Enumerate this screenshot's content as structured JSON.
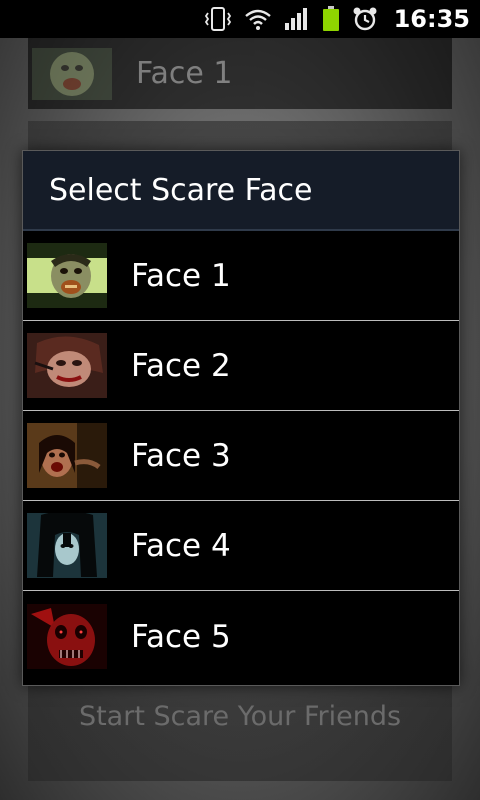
{
  "status_bar": {
    "time": "16:35",
    "icons": [
      "vibrate-icon",
      "wifi-icon",
      "signal-icon",
      "battery-icon",
      "alarm-icon"
    ]
  },
  "background": {
    "spinner_label": "Face 1",
    "start_button_label": "Start Scare Your Friends"
  },
  "dialog": {
    "title": "Select Scare Face",
    "items": [
      {
        "label": "Face 1"
      },
      {
        "label": "Face 2"
      },
      {
        "label": "Face 3"
      },
      {
        "label": "Face 4"
      },
      {
        "label": "Face 5"
      }
    ]
  },
  "colors": {
    "dialog_title_bg": "#151c28",
    "list_bg": "#000000",
    "battery": "#8fd400"
  }
}
